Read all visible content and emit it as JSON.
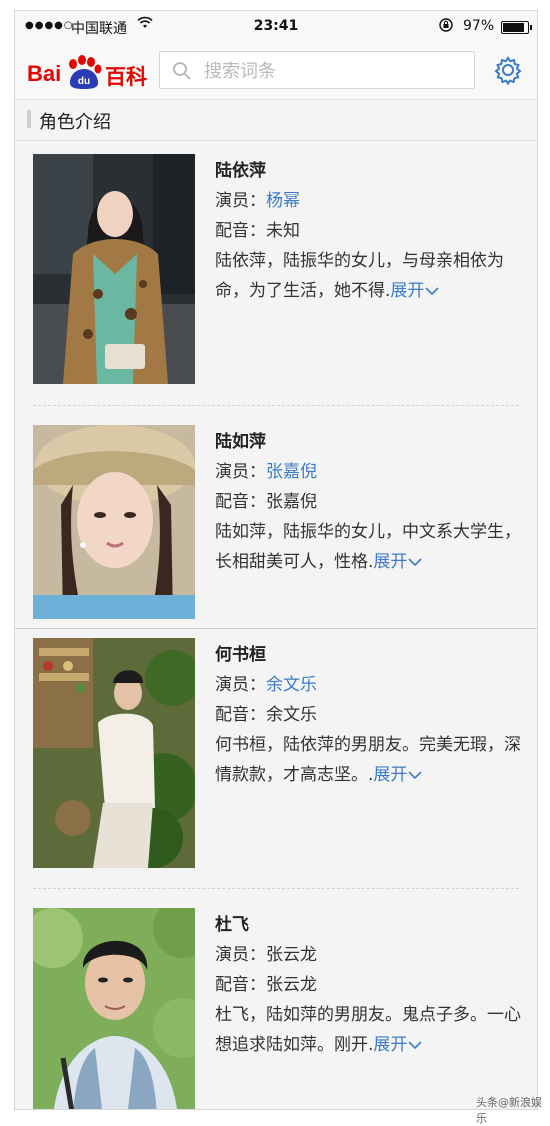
{
  "status_bar": {
    "carrier": "中国联通",
    "time": "23:41",
    "battery_percent": "97%",
    "battery_level": 0.97
  },
  "header": {
    "logo_left": "Bai",
    "logo_paw": "du",
    "logo_right": "百科",
    "search_placeholder": "搜索词条",
    "brand_color": "#e10601",
    "accent_color": "#3c7bc8"
  },
  "section": {
    "title": "角色介绍"
  },
  "characters": [
    {
      "name": "陆依萍",
      "actor_label": "演员：",
      "actor": "杨幂",
      "voice_label": "配音：",
      "voice": "未知",
      "description": "陆依萍，陆振华的女儿，与母亲相依为命，为了生活，她不得.",
      "expand": "展开"
    },
    {
      "name": "陆如萍",
      "actor_label": "演员：",
      "actor": "张嘉倪",
      "voice_label": "配音：",
      "voice": "张嘉倪",
      "description": "陆如萍，陆振华的女儿，中文系大学生，长相甜美可人，性格.",
      "expand": "展开"
    },
    {
      "name": "何书桓",
      "actor_label": "演员：",
      "actor": "余文乐",
      "voice_label": "配音：",
      "voice": "余文乐",
      "description": "何书桓，陆依萍的男朋友。完美无瑕，深情款款，才高志坚。.",
      "expand": "展开"
    },
    {
      "name": "杜飞",
      "actor_label": "演员：",
      "actor": "张云龙",
      "voice_label": "配音：",
      "voice": "张云龙",
      "description": "杜飞，陆如萍的男朋友。鬼点子多。一心想追求陆如萍。刚开.",
      "expand": "展开"
    }
  ],
  "watermark": "头条@新浪娱乐"
}
